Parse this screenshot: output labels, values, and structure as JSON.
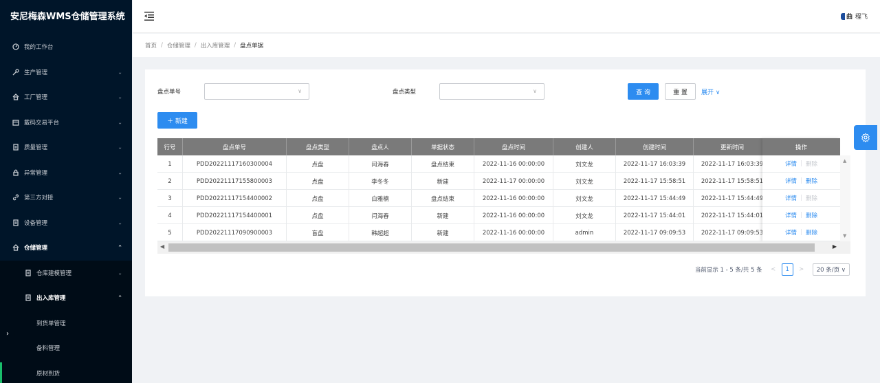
{
  "app": {
    "title": "安尼梅森WMS仓储管理系统"
  },
  "sidebar": {
    "items": [
      {
        "label": "我的工作台",
        "icon": "dashboard-icon",
        "has_children": false
      },
      {
        "label": "生产管理",
        "icon": "wrench-icon",
        "has_children": true
      },
      {
        "label": "工厂管理",
        "icon": "home-icon",
        "has_children": true
      },
      {
        "label": "戴码交易平台",
        "icon": "calendar-icon",
        "has_children": true
      },
      {
        "label": "质量管理",
        "icon": "document-icon",
        "has_children": true
      },
      {
        "label": "异常管理",
        "icon": "lock-icon",
        "has_children": true
      },
      {
        "label": "第三方对接",
        "icon": "link-icon",
        "has_children": true
      },
      {
        "label": "设备管理",
        "icon": "document-icon",
        "has_children": true
      },
      {
        "label": "仓储管理",
        "icon": "home-icon",
        "has_children": true,
        "active": true
      }
    ],
    "submenu": [
      {
        "label": "仓库建模管理",
        "chevron": "down"
      },
      {
        "label": "出入库管理",
        "chevron": "up"
      }
    ],
    "submenu2": [
      {
        "label": "到货单管理"
      },
      {
        "label": "备料管理"
      },
      {
        "label": "原材到货"
      }
    ],
    "collapse_glyph": "›"
  },
  "header": {
    "brand_short": "程飞",
    "logo_text": "曲"
  },
  "breadcrumb": [
    "首页",
    "仓储管理",
    "出入库管理",
    "盘点单据"
  ],
  "filters": {
    "order_no_label": "盘点单号",
    "type_label": "盘点类型",
    "search_label": "查 询",
    "reset_label": "重 置",
    "expand_label": "展开 ∨",
    "new_label": "＋ 新建"
  },
  "table": {
    "columns": [
      "行号",
      "盘点单号",
      "盘点类型",
      "盘点人",
      "单据状态",
      "盘点时间",
      "创建人",
      "创建时间",
      "更新时间",
      "操作"
    ],
    "rows": [
      [
        "1",
        "PDD20221117160300004",
        "点盘",
        "闫海春",
        "盘点结束",
        "2022-11-16 00:00:00",
        "刘文龙",
        "2022-11-17 16:03:39",
        "2022-11-17 16:03:39"
      ],
      [
        "2",
        "PDD20221117155800003",
        "点盘",
        "李冬冬",
        "新建",
        "2022-11-17 00:00:00",
        "刘文龙",
        "2022-11-17 15:58:51",
        "2022-11-17 15:58:51"
      ],
      [
        "3",
        "PDD20221117154400002",
        "点盘",
        "白雅楠",
        "盘点结束",
        "2022-11-16 00:00:00",
        "刘文龙",
        "2022-11-17 15:44:49",
        "2022-11-17 15:44:49"
      ],
      [
        "4",
        "PDD20221117154400001",
        "点盘",
        "闫海春",
        "新建",
        "2022-11-16 00:00:00",
        "刘文龙",
        "2022-11-17 15:44:01",
        "2022-11-17 15:44:01"
      ],
      [
        "5",
        "PDD20221117090900003",
        "盲盘",
        "韩超超",
        "新建",
        "2022-11-16 00:00:00",
        "admin",
        "2022-11-17 09:09:53",
        "2022-11-17 09:09:53"
      ]
    ],
    "ops": [
      {
        "detail": "详情",
        "delete": "删除",
        "delete_enabled": false
      },
      {
        "detail": "详情",
        "delete": "删除",
        "delete_enabled": true
      },
      {
        "detail": "详情",
        "delete": "删除",
        "delete_enabled": false
      },
      {
        "detail": "详情",
        "delete": "删除",
        "delete_enabled": true
      },
      {
        "detail": "详情",
        "delete": "删除",
        "delete_enabled": true
      }
    ]
  },
  "pagination": {
    "summary": "当前显示 1 - 5 条/共 5 条",
    "current_page": "1",
    "page_size": "20 条/页 ∨"
  }
}
